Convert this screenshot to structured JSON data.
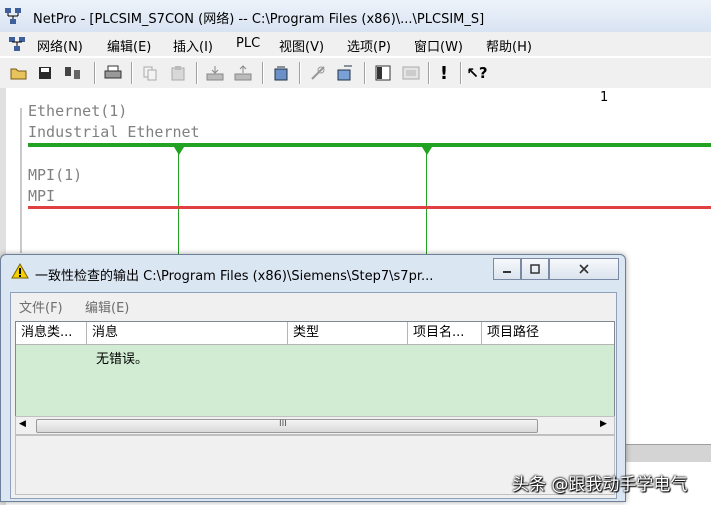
{
  "window": {
    "title": "NetPro - [PLCSIM_S7CON (网络) -- C:\\Program Files (x86)\\...\\PLCSIM_S]"
  },
  "menubar": {
    "items": [
      "网络(N)",
      "编辑(E)",
      "插入(I)",
      "PLC",
      "视图(V)",
      "选项(P)",
      "窗口(W)",
      "帮助(H)"
    ]
  },
  "toolbar": {
    "icons": [
      "open-folder-icon",
      "save-icon",
      "network-settings-icon",
      "print-icon",
      "copy-icon",
      "paste-icon",
      "download-icon",
      "upload-icon",
      "configure-icon",
      "connection-icon",
      "properties-icon",
      "catalog-icon",
      "zoom-icon",
      "consistency-check-icon",
      "help-context-icon"
    ]
  },
  "canvas": {
    "column_number": "1",
    "ethernet": {
      "name": "Ethernet(1)",
      "type": "Industrial Ethernet",
      "color": "#22a122"
    },
    "mpi": {
      "name": "MPI(1)",
      "type": "MPI",
      "color": "#e04040"
    }
  },
  "dialog": {
    "title": "一致性检查的输出  C:\\Program Files (x86)\\Siemens\\Step7\\s7pr...",
    "menu": [
      "文件(F)",
      "编辑(E)"
    ],
    "columns": [
      "消息类...",
      "消息",
      "类型",
      "项目名...",
      "项目路径"
    ],
    "rows": [
      {
        "message": "无错误。"
      }
    ],
    "row_color": "#d2ebd3",
    "scroll_grip": "III"
  },
  "watermark": "头条 @跟我动手学电气"
}
